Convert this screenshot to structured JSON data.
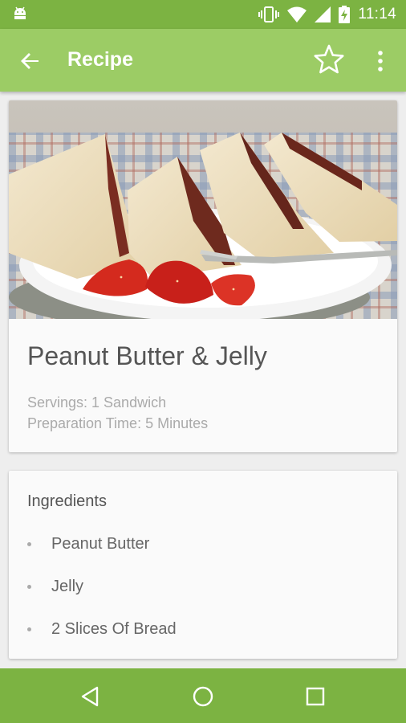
{
  "status_bar": {
    "time": "11:14",
    "icons": [
      "android-icon",
      "vibrate-icon",
      "wifi-icon",
      "signal-icon",
      "battery-charging-icon"
    ]
  },
  "app_bar": {
    "title": "Recipe",
    "icons": [
      "back-arrow-icon",
      "star-outline-icon",
      "more-vert-icon"
    ]
  },
  "recipe": {
    "image": "pb-and-j-sandwich-photo",
    "title": "Peanut Butter & Jelly",
    "servings": "Servings: 1 Sandwich",
    "prep_time": "Preparation Time: 5 Minutes"
  },
  "ingredients": {
    "header": "Ingredients",
    "items": [
      "Peanut Butter",
      "Jelly",
      "2 Slices Of Bread"
    ]
  },
  "nav_bar": {
    "icons": [
      "back-triangle-icon",
      "home-circle-icon",
      "recents-square-icon"
    ]
  },
  "colors": {
    "status_bar": "#7cb342",
    "app_bar": "#9ccc65",
    "nav_bar": "#7cb342",
    "background": "#eeeeee",
    "card": "#fafafa"
  }
}
